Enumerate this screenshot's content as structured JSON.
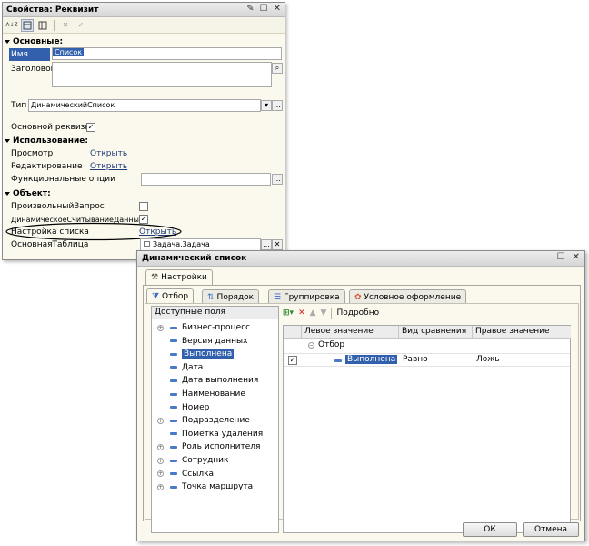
{
  "props": {
    "title": "Свойства: Реквизит",
    "toolbar": {
      "sort_az": "A↓Z",
      "close": "✕",
      "check": "✓"
    },
    "sections": {
      "main": "Основные:",
      "usage": "Использование:",
      "object": "Объект:"
    },
    "name_label": "Имя",
    "name_value": "Список",
    "caption_label": "Заголовок",
    "type_label": "Тип",
    "type_value": "ДинамическийСписок",
    "main_attr_label": "Основной реквизит",
    "view_label": "Просмотр",
    "view_link": "Открыть",
    "edit_label": "Редактирование",
    "edit_link": "Открыть",
    "func_label": "Функциональные опции",
    "custom_query_label": "ПроизвольныйЗапрос",
    "dynamic_read_label": "ДинамическоеСчитываниеДанных",
    "list_settings_label": "Настройка списка",
    "list_settings_link": "Открыть",
    "main_table_label": "ОсновнаяТаблица",
    "main_table_value": "Задача.Задача"
  },
  "dyn": {
    "title": "Динамический список",
    "settings_tab": "Настройки",
    "tabs": [
      "Отбор",
      "Порядок",
      "Группировка",
      "Условное оформление"
    ],
    "fields_header": "Доступные поля",
    "fields": [
      {
        "name": "Бизнес-процесс",
        "expandable": true
      },
      {
        "name": "Версия данных",
        "expandable": false
      },
      {
        "name": "Выполнена",
        "expandable": false,
        "selected": true
      },
      {
        "name": "Дата",
        "expandable": false
      },
      {
        "name": "Дата выполнения",
        "expandable": false
      },
      {
        "name": "Наименование",
        "expandable": false
      },
      {
        "name": "Номер",
        "expandable": false
      },
      {
        "name": "Подразделение",
        "expandable": true
      },
      {
        "name": "Пометка удаления",
        "expandable": false
      },
      {
        "name": "Роль исполнителя",
        "expandable": true
      },
      {
        "name": "Сотрудник",
        "expandable": true
      },
      {
        "name": "Ссылка",
        "expandable": true
      },
      {
        "name": "Точка маршрута",
        "expandable": true
      }
    ],
    "detail_label": "Подробно",
    "columns": [
      "Левое значение",
      "Вид сравнения",
      "Правое значение"
    ],
    "group_row": "Отбор",
    "filter_row": {
      "left": "Выполнена",
      "comparison": "Равно",
      "right": "Ложь"
    },
    "ok": "ОК",
    "cancel": "Отмена"
  }
}
